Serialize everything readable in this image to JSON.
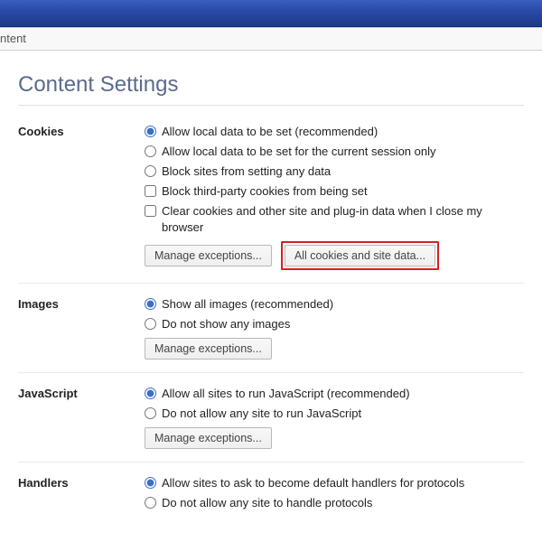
{
  "toolbar": {
    "crumb": "ntent"
  },
  "page": {
    "title": "Content Settings"
  },
  "cookies": {
    "label": "Cookies",
    "opt_allow": "Allow local data to be set (recommended)",
    "opt_session": "Allow local data to be set for the current session only",
    "opt_block": "Block sites from setting any data",
    "opt_block_third": "Block third-party cookies from being set",
    "opt_clear_exit": "Clear cookies and other site and plug-in data when I close my browser",
    "btn_exceptions": "Manage exceptions...",
    "btn_all_cookies": "All cookies and site data..."
  },
  "images": {
    "label": "Images",
    "opt_show": "Show all images (recommended)",
    "opt_hide": "Do not show any images",
    "btn_exceptions": "Manage exceptions..."
  },
  "javascript": {
    "label": "JavaScript",
    "opt_allow": "Allow all sites to run JavaScript (recommended)",
    "opt_block": "Do not allow any site to run JavaScript",
    "btn_exceptions": "Manage exceptions..."
  },
  "handlers": {
    "label": "Handlers",
    "opt_allow": "Allow sites to ask to become default handlers for protocols",
    "opt_block": "Do not allow any site to handle protocols"
  }
}
